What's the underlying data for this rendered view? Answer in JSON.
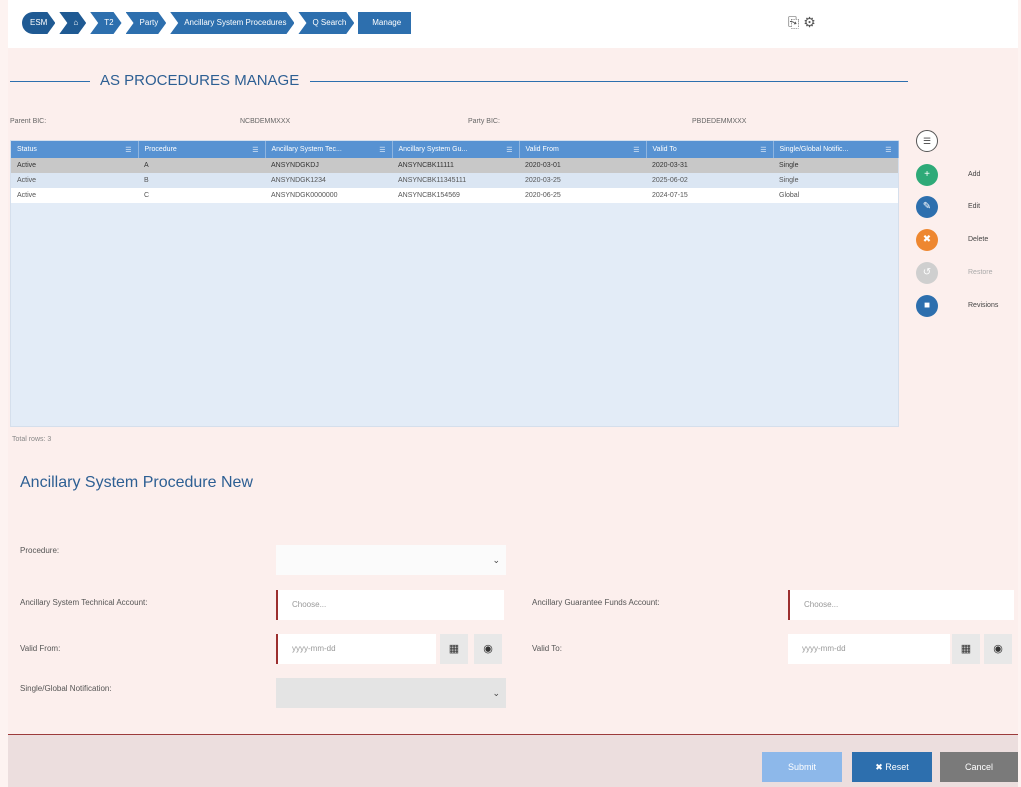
{
  "breadcrumb": [
    "ESM",
    "⌂",
    "T2",
    "Party",
    "Ancillary System Procedures",
    "Q Search",
    "Manage"
  ],
  "toolbar_icons": [
    "print-icon",
    "settings-icon"
  ],
  "header": {
    "title": "AS PROCEDURES MANAGE"
  },
  "info": {
    "parent_bic_label": "Parent BIC:",
    "parent_bic_value": "NCBDEMMXXX",
    "party_bic_label": "Party BIC:",
    "party_bic_value": "PBDEDEMMXXX"
  },
  "table": {
    "columns": [
      "Status",
      "Procedure",
      "Ancillary System Tec...",
      "Ancillary System Gu...",
      "Valid From",
      "Valid To",
      "Single/Global Notific..."
    ],
    "rows": [
      [
        "Active",
        "A",
        "ANSYNDGKDJ",
        "ANSYNCBK11111",
        "2020-03-01",
        "2020-03-31",
        "Single"
      ],
      [
        "Active",
        "B",
        "ANSYNDGK1234",
        "ANSYNCBK11345111",
        "2020-03-25",
        "2025-06-02",
        "Single"
      ],
      [
        "Active",
        "C",
        "ANSYNDGK0000000",
        "ANSYNCBK154569",
        "2020-06-25",
        "2024-07-15",
        "Global"
      ]
    ],
    "total_label": "Total rows: 3"
  },
  "actions": [
    {
      "label": "Add",
      "icon": "plus-icon",
      "glyph": "+",
      "color": "#2eaa78",
      "enabled": true
    },
    {
      "label": "Edit",
      "icon": "edit-icon",
      "glyph": "✎",
      "color": "#2d6fae",
      "enabled": true
    },
    {
      "label": "Delete",
      "icon": "delete-icon",
      "glyph": "✖",
      "color": "#ee8730",
      "enabled": true
    },
    {
      "label": "Restore",
      "icon": "restore-icon",
      "glyph": "↺",
      "color": "#cfcfcf",
      "enabled": false
    },
    {
      "label": "Revisions",
      "icon": "revisions-icon",
      "glyph": "■",
      "color": "#2d6fae",
      "enabled": true
    }
  ],
  "form": {
    "title": "Ancillary System Procedure New",
    "procedure_label": "Procedure:",
    "procedure_value": "",
    "tech_account_label": "Ancillary System Technical Account:",
    "tech_account_placeholder": "Choose...",
    "guarantee_label": "Ancillary Guarantee Funds Account:",
    "guarantee_placeholder": "Choose...",
    "valid_from_label": "Valid From:",
    "valid_from_placeholder": "yyyy-mm-dd",
    "valid_to_label": "Valid To:",
    "valid_to_placeholder": "yyyy-mm-dd",
    "notification_label": "Single/Global Notification:",
    "notification_value": ""
  },
  "footer": {
    "submit": "Submit",
    "reset": "✖ Reset",
    "cancel": "Cancel"
  },
  "colors": {
    "primary": "#2d6fae",
    "header_blue": "#5792d2",
    "required_marker": "#9c2f2f",
    "submit_disabled": "#8db8ea",
    "reset": "#2d6fae",
    "cancel": "#7a7a7a"
  }
}
